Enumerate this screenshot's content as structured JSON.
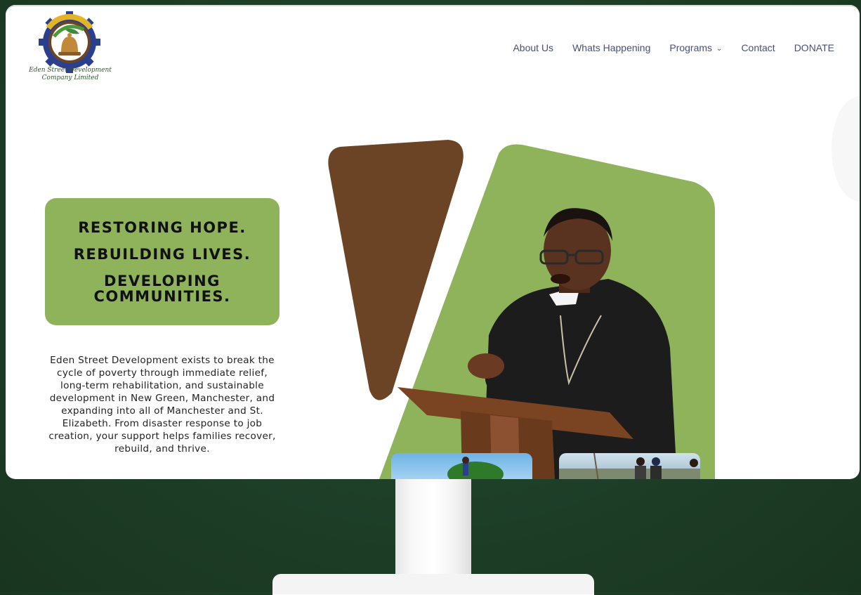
{
  "brand": {
    "name_line1": "Eden Street Development",
    "name_line2": "Company Limited",
    "colors": {
      "green": "#8fb35a",
      "brown": "#6b4426",
      "nav_text": "#48507a",
      "background": "#1d3d27"
    }
  },
  "nav": {
    "items": [
      {
        "label": "About Us"
      },
      {
        "label": "Whats Happening"
      },
      {
        "label": "Programs",
        "has_dropdown": true
      },
      {
        "label": "Contact"
      },
      {
        "label": "DONATE"
      }
    ]
  },
  "hero": {
    "headline": [
      "RESTORING HOPE.",
      "REBUILDING LIVES.",
      "DEVELOPING",
      "COMMUNITIES."
    ],
    "body": "Eden Street Development exists to break the cycle of poverty through immediate relief, long-term rehabilitation, and sustainable development in New Green, Manchester, and expanding into all of Manchester and St. Elizabeth. From disaster response to job creation, your support helps families recover, rebuild, and thrive."
  },
  "icons": {
    "dropdown": "chevron-down-icon",
    "logo": "gear-bell-logo-icon"
  }
}
